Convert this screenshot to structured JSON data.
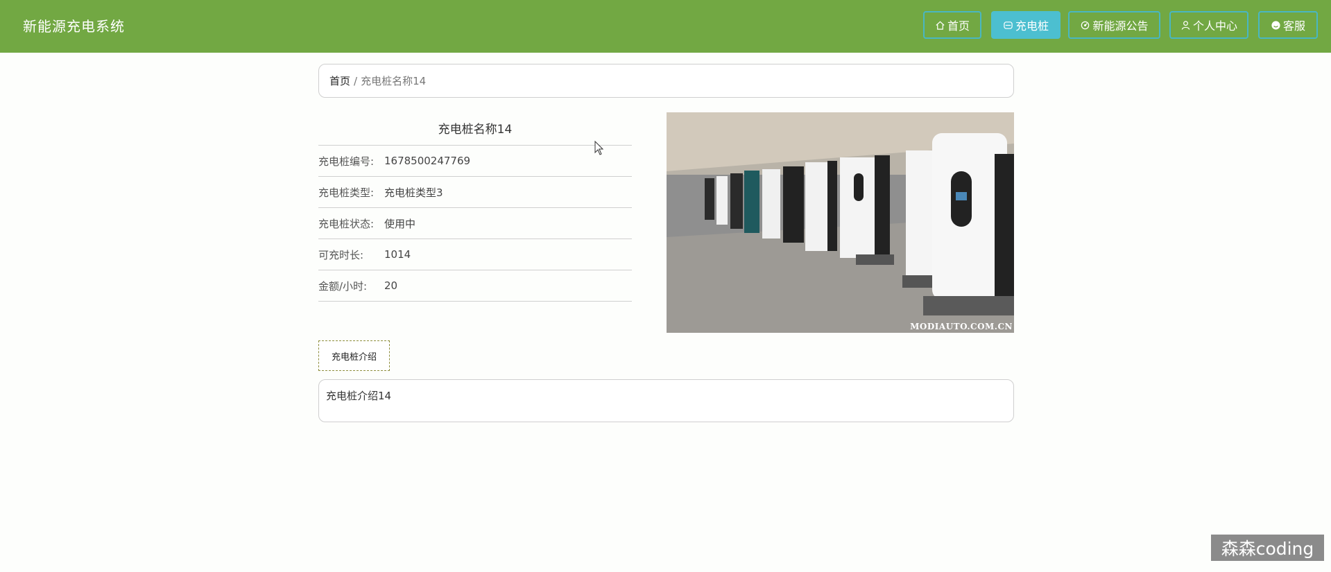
{
  "header": {
    "brand": "新能源充电系统",
    "nav": [
      {
        "label": "首页",
        "icon": "home-icon"
      },
      {
        "label": "充电桩",
        "icon": "charging-station-icon",
        "active": true
      },
      {
        "label": "新能源公告",
        "icon": "announcement-icon"
      },
      {
        "label": "个人中心",
        "icon": "user-icon"
      },
      {
        "label": "客服",
        "icon": "customer-service-icon"
      }
    ]
  },
  "breadcrumb": {
    "home": "首页",
    "separator": "/",
    "current": "充电桩名称14"
  },
  "detail": {
    "title": "充电桩名称14",
    "rows": [
      {
        "label": "充电桩编号:",
        "value": "1678500247769"
      },
      {
        "label": "充电桩类型:",
        "value": "充电桩类型3"
      },
      {
        "label": "充电桩状态:",
        "value": "使用中"
      },
      {
        "label": "可充时长:",
        "value": "1014"
      },
      {
        "label": "金额/小时:",
        "value": "20"
      }
    ],
    "photo_watermark": "MODIAUTO.COM.CN"
  },
  "intro": {
    "tab_label": "充电桩介绍",
    "content": "充电桩介绍14"
  },
  "corner_watermark": "森森coding",
  "colors": {
    "header": "#72a843",
    "nav_border": "#49b7c3",
    "nav_active": "#4cbfd0"
  }
}
